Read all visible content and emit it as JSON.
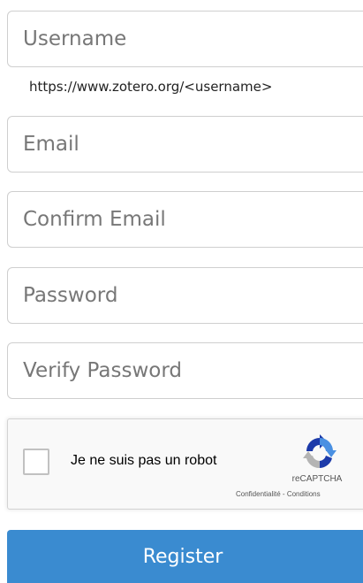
{
  "form": {
    "username": {
      "placeholder": "Username",
      "value": ""
    },
    "username_hint": "https://www.zotero.org/<username>",
    "email": {
      "placeholder": "Email",
      "value": ""
    },
    "confirm_email": {
      "placeholder": "Confirm Email",
      "value": ""
    },
    "password": {
      "placeholder": "Password",
      "value": ""
    },
    "verify_password": {
      "placeholder": "Verify Password",
      "value": ""
    }
  },
  "recaptcha": {
    "checkbox_label": "Je ne suis pas un robot",
    "brand": "reCAPTCHA",
    "privacy_link": "Confidentialité",
    "separator": " - ",
    "terms_link": "Conditions",
    "colors": {
      "logo_blue": "#4a90e2",
      "logo_dark": "#1c3aa9",
      "logo_gray": "#b4b4b4"
    }
  },
  "register_button": {
    "label": "Register",
    "color": "#3a8bd0"
  }
}
